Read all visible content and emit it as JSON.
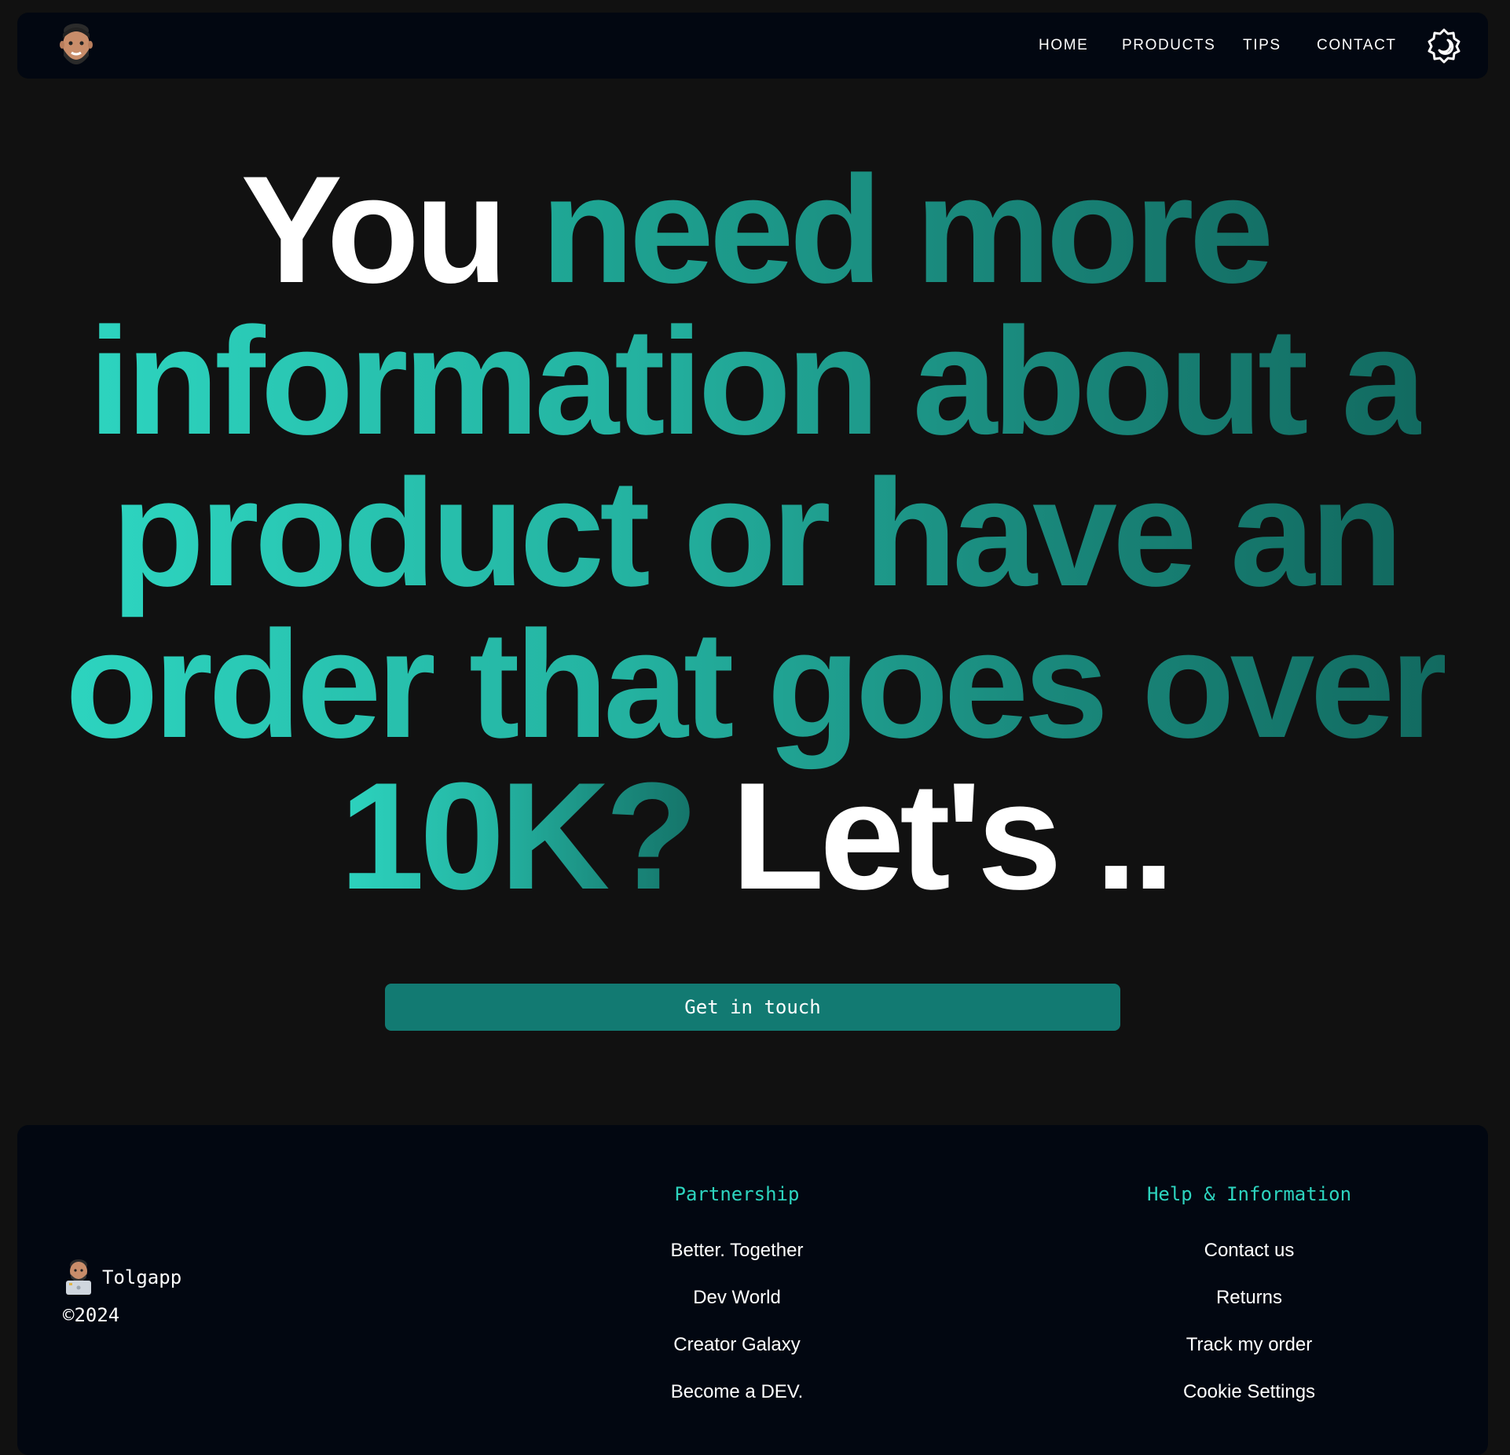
{
  "nav": {
    "avatar": "memoji-avatar",
    "links": [
      "HOME",
      "PRODUCTS",
      "TIPS",
      "CONTACT"
    ],
    "theme_icon": "theme-toggle-icon"
  },
  "hero": {
    "line1": {
      "white": "You ",
      "accent": "need more"
    },
    "line2": {
      "accent": "information about a"
    },
    "line3": {
      "accent": "product or have an"
    },
    "line4": {
      "accent": "order that goes over"
    },
    "line5": {
      "accent": "10K? ",
      "white": "Let's .."
    },
    "cta_label": "Get in touch"
  },
  "footer": {
    "brand_name": "Tolgapp",
    "year": "©2024",
    "partnership": {
      "heading": "Partnership",
      "links": [
        "Better. Together",
        "Dev World",
        "Creator Galaxy",
        "Become a DEV."
      ]
    },
    "help": {
      "heading": "Help & Information",
      "links": [
        "Contact us",
        "Returns",
        "Track my order",
        "Cookie Settings"
      ]
    }
  },
  "colors": {
    "page_bg": "#111111",
    "panel_bg": "#020711",
    "accent": "#2dd4bf",
    "accent_dark": "#127a72",
    "text": "#ffffff"
  }
}
